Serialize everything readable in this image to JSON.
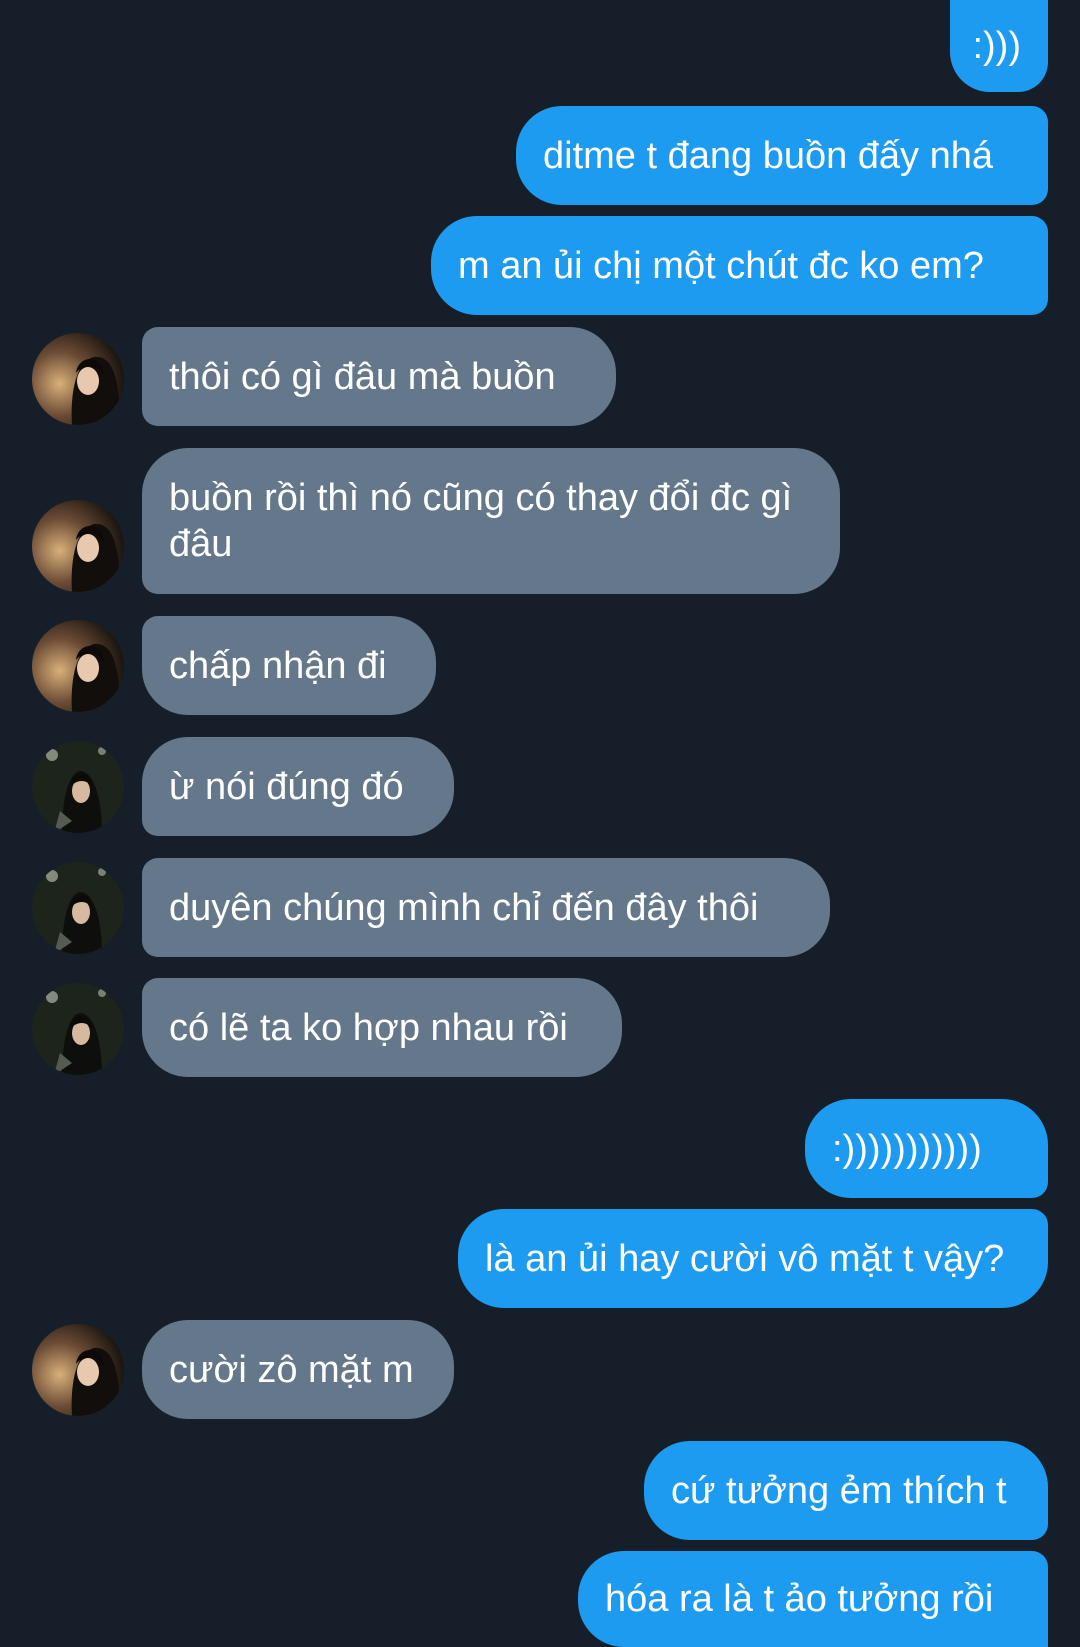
{
  "messages": [
    {
      "side": "out",
      "text": ":)))"
    },
    {
      "side": "out",
      "text": "ditme t đang buồn đấy nhá"
    },
    {
      "side": "out",
      "text": "m an ủi chị một chút đc ko em?"
    },
    {
      "side": "in",
      "text": "thôi có gì đâu mà buồn",
      "avatar": "avatar-a"
    },
    {
      "side": "in",
      "text": "buồn rồi thì nó cũng có thay đổi đc gì đâu",
      "avatar": "avatar-a"
    },
    {
      "side": "in",
      "text": "chấp nhận đi",
      "avatar": "avatar-a"
    },
    {
      "side": "in",
      "text": "ừ nói đúng đó",
      "avatar": "avatar-b"
    },
    {
      "side": "in",
      "text": "duyên chúng mình chỉ đến đây thôi",
      "avatar": "avatar-b"
    },
    {
      "side": "in",
      "text": "có lẽ ta ko hợp nhau rồi",
      "avatar": "avatar-b"
    },
    {
      "side": "out",
      "text": ":)))))))))))"
    },
    {
      "side": "out",
      "text": "là an ủi hay cười vô mặt t vậy?"
    },
    {
      "side": "in",
      "text": "cười zô mặt m",
      "avatar": "avatar-a"
    },
    {
      "side": "out",
      "text": "cứ tưởng ẻm thích t"
    },
    {
      "side": "out",
      "text": "hóa ra là t ảo tưởng rồi"
    }
  ],
  "colors": {
    "background": "#161f29",
    "outgoing_bubble": "#1d9bf0",
    "incoming_bubble": "#65778a",
    "text": "#ffffff"
  }
}
